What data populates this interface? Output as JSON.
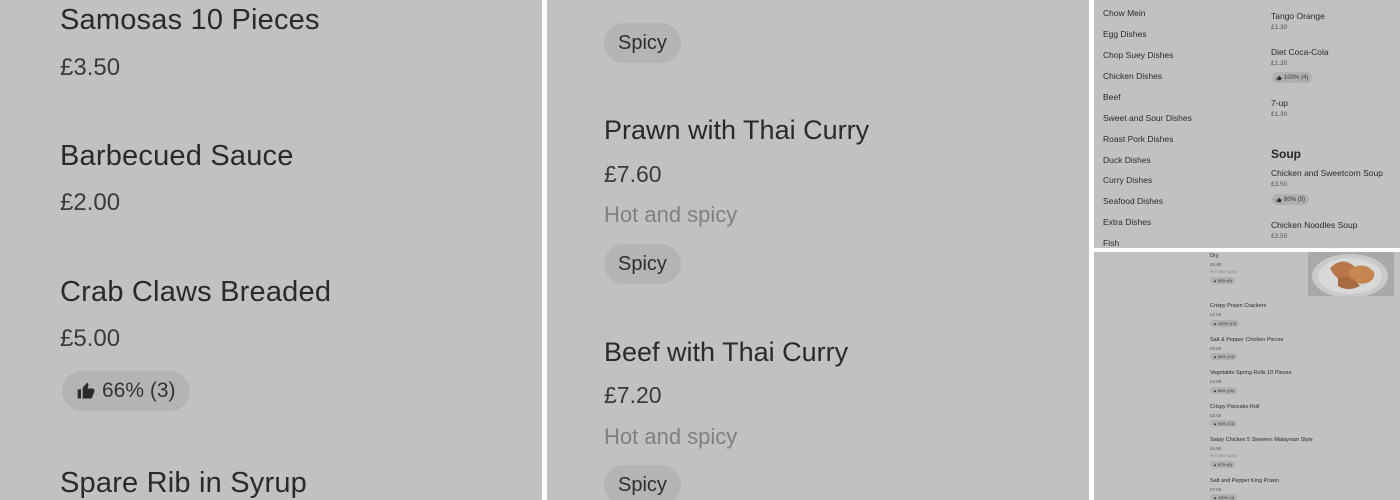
{
  "panel1": {
    "items": [
      {
        "name": "Samosas 10 Pieces",
        "price": "£3.50"
      },
      {
        "name": "Barbecued Sauce",
        "price": "£2.00"
      },
      {
        "name": "Crab Claws Breaded",
        "price": "£5.00",
        "rating": "66% (3)"
      },
      {
        "name": "Spare Rib in Syrup"
      }
    ]
  },
  "panel2": {
    "top_tag": "Spicy",
    "items": [
      {
        "name": "Prawn with Thai Curry",
        "price": "£7.60",
        "desc": "Hot and spicy",
        "tag": "Spicy"
      },
      {
        "name": "Beef with Thai Curry",
        "price": "£7.20",
        "desc": "Hot and spicy",
        "tag": "Spicy"
      }
    ]
  },
  "panel3": {
    "categories": [
      "Chow Mein",
      "Egg Dishes",
      "Chop Suey Dishes",
      "Chicken Dishes",
      "Beef",
      "Sweet and Sour Dishes",
      "Roast Pork Dishes",
      "Duck Dishes",
      "Curry Dishes",
      "Seafood Dishes",
      "Extra Dishes",
      "Fish"
    ],
    "drinks": [
      {
        "name": "Tango Orange",
        "price": "£1.30"
      },
      {
        "name": "Diet Coca-Cola",
        "price": "£1.30",
        "rating": "100% (4)"
      },
      {
        "name": "7-up",
        "price": "£1.30"
      }
    ],
    "soup_heading": "Soup",
    "soups": [
      {
        "name": "Chicken and Sweetcorn Soup",
        "price": "£3.50",
        "rating": "80% (5)"
      },
      {
        "name": "Chicken Noodles Soup",
        "price": "£3.50"
      }
    ]
  },
  "panel4": {
    "first": {
      "name": "Dry",
      "price": "£6.80",
      "desc": "Hot and spicy",
      "rating": "83% (6)"
    },
    "items": [
      {
        "name": "Crispy Prawn Crackers",
        "price": "£2.00",
        "rating": "100% (10)"
      },
      {
        "name": "Salt & Pepper Chicken Pieces",
        "price": "£6.80",
        "rating": "84% (13)"
      },
      {
        "name": "Vegetable Spring Rolls 10 Pieces",
        "price": "£3.50",
        "rating": "88% (25)"
      },
      {
        "name": "Crispy Pancake Roll",
        "price": "£2.50",
        "rating": "92% (13)"
      },
      {
        "name": "Satay Chicken 5 Skewers Malaysian Style",
        "price": "£6.50",
        "desc": "Hot and spicy",
        "rating": "87% (8)"
      },
      {
        "name": "Salt and Pepper King Prawn",
        "price": "£7.60",
        "rating": "100% (4)"
      }
    ]
  },
  "icons": {
    "thumbs_up": "thumbs-up-icon"
  }
}
